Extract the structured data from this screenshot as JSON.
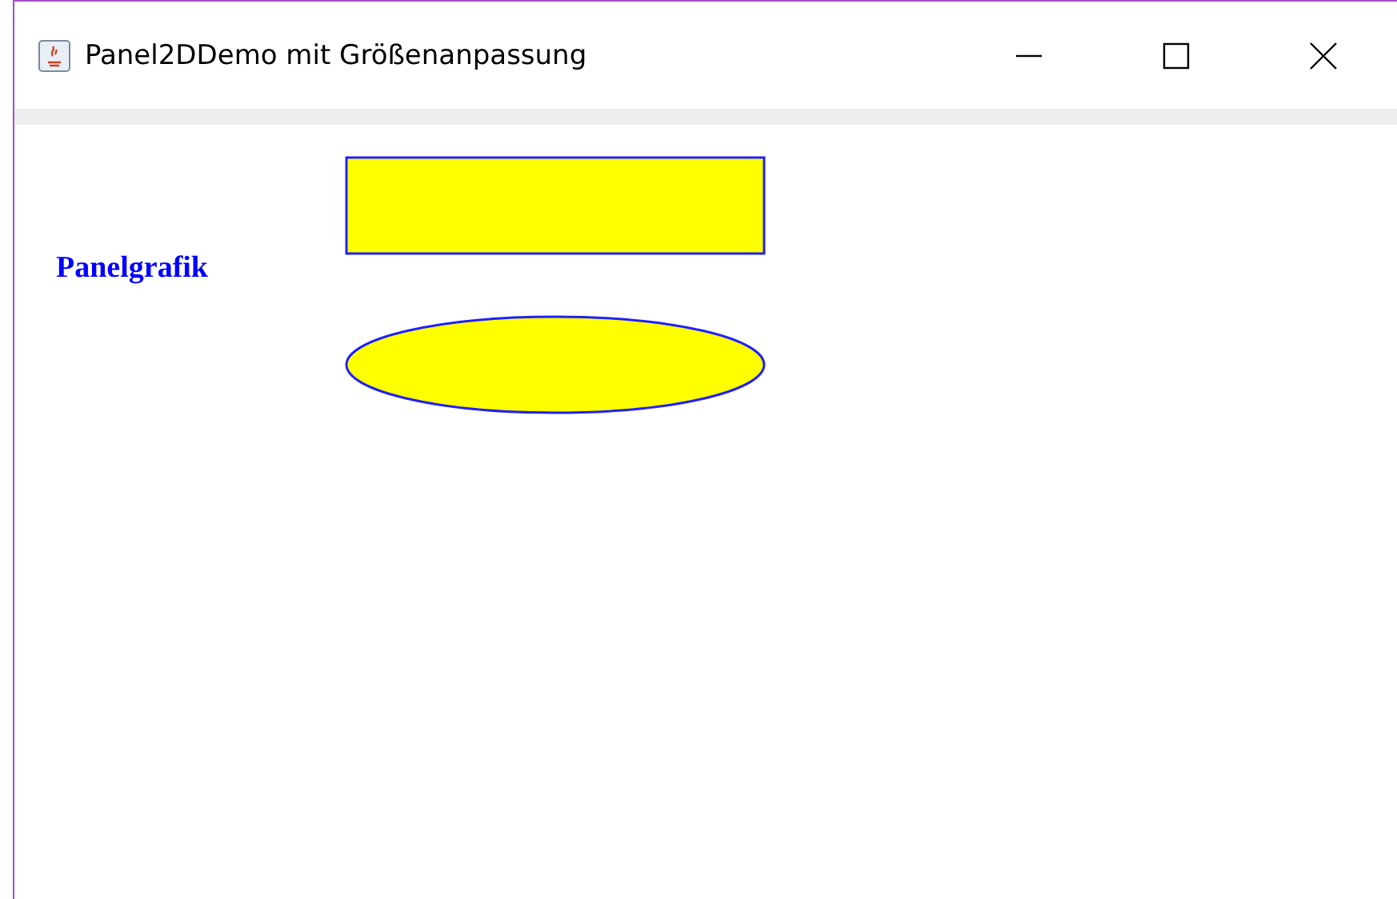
{
  "window": {
    "title": "Panel2DDemo mit Größenanpassung"
  },
  "canvas": {
    "label": "Panelgrafik",
    "shapes": [
      {
        "kind": "rectangle"
      },
      {
        "kind": "ellipse"
      }
    ]
  }
}
